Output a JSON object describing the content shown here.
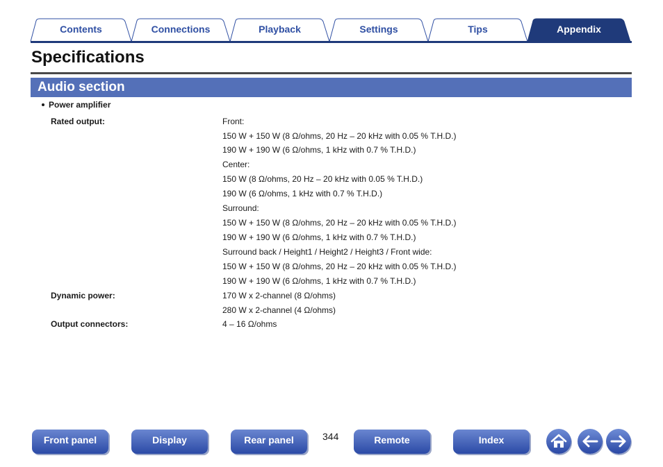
{
  "tabs": [
    {
      "label": "Contents",
      "active": false
    },
    {
      "label": "Connections",
      "active": false
    },
    {
      "label": "Playback",
      "active": false
    },
    {
      "label": "Settings",
      "active": false
    },
    {
      "label": "Tips",
      "active": false
    },
    {
      "label": "Appendix",
      "active": true
    }
  ],
  "page": {
    "title": "Specifications",
    "section": "Audio section",
    "number": "344"
  },
  "spec": {
    "bullet": "Power amplifier",
    "rated_output": {
      "label": "Rated output:",
      "lines": [
        "Front:",
        "150 W + 150 W (8 Ω/ohms, 20 Hz – 20 kHz with 0.05 % T.H.D.)",
        "190 W + 190 W (6 Ω/ohms, 1 kHz with 0.7 % T.H.D.)",
        "Center:",
        "150 W (8 Ω/ohms, 20 Hz – 20 kHz with 0.05 % T.H.D.)",
        "190 W (6 Ω/ohms, 1 kHz with 0.7 % T.H.D.)",
        "Surround:",
        "150 W + 150 W (8 Ω/ohms, 20 Hz – 20 kHz with 0.05 % T.H.D.)",
        "190 W + 190 W (6 Ω/ohms, 1 kHz with 0.7 % T.H.D.)",
        "Surround back / Height1 / Height2 / Height3 / Front wide:",
        "150 W + 150 W (8 Ω/ohms, 20 Hz – 20 kHz with 0.05 % T.H.D.)",
        "190 W + 190 W (6 Ω/ohms, 1 kHz with 0.7 % T.H.D.)"
      ]
    },
    "dynamic_power": {
      "label": "Dynamic power:",
      "lines": [
        "170 W x 2-channel (8 Ω/ohms)",
        "280 W x 2-channel (4 Ω/ohms)"
      ]
    },
    "output_connectors": {
      "label": "Output connectors:",
      "lines": [
        "4 – 16 Ω/ohms"
      ]
    }
  },
  "bottom_nav": {
    "front_panel": "Front panel",
    "display": "Display",
    "rear_panel": "Rear panel",
    "remote": "Remote",
    "index": "Index",
    "home_icon": "home-icon",
    "back_icon": "arrow-left-icon",
    "forward_icon": "arrow-right-icon"
  },
  "colors": {
    "tab_text": "#2f4fa3",
    "tab_active_fill": "#1f3a7a",
    "section_bar": "#5470b8",
    "button_gradient_top": "#6a86d0",
    "button_gradient_bottom": "#2b4aa6"
  }
}
